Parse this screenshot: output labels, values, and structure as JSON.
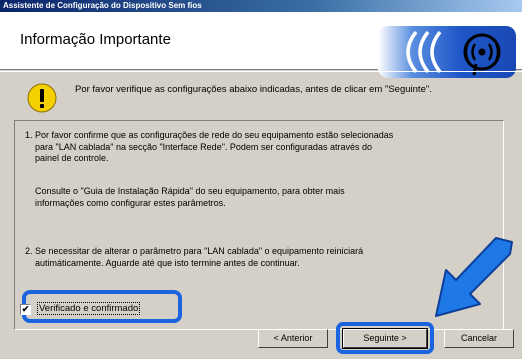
{
  "window": {
    "title": "Assistente de Configuração do Dispositivo Sem fios"
  },
  "header": {
    "title": "Informação Importante"
  },
  "warning": {
    "text": "Por favor verifique as configurações abaixo indicadas, antes de clicar em \"Seguinte\"."
  },
  "body": {
    "p1_line1": "1. Por favor confirme que as configurações de rede do seu equipamento estão selecionadas",
    "p1_line2": "para \"LAN cablada\" na secção \"Interface Rede\". Podem ser configuradas através do",
    "p1_line3": "painel de controle.",
    "p2_line1": "Consulte o \"Guia de Instalação Rápida\" do seu equipamento, para obter mais",
    "p2_line2": "informações como configurar estes parâmetros.",
    "p3_line1": "2. Se necessitar de alterar o parâmetro para \"LAN cablada\" o equipamento reiniciará",
    "p3_line2": "autimáticamente. Aguarde até que isto termine antes de continuar."
  },
  "checkbox": {
    "label": "Verificado e confirmado",
    "checked": true,
    "mark": "✔"
  },
  "buttons": {
    "back": "< Anterior",
    "next": "Seguinte >",
    "cancel": "Cancelar"
  },
  "colors": {
    "highlight": "#1a64e0",
    "arrow": "#1e78e6",
    "titlebar": "#0a246a",
    "dialog": "#d4d0c8"
  },
  "icons": {
    "warning": "warning-icon",
    "logo": "wireless-logo-icon",
    "arrow": "pointer-arrow-icon"
  }
}
